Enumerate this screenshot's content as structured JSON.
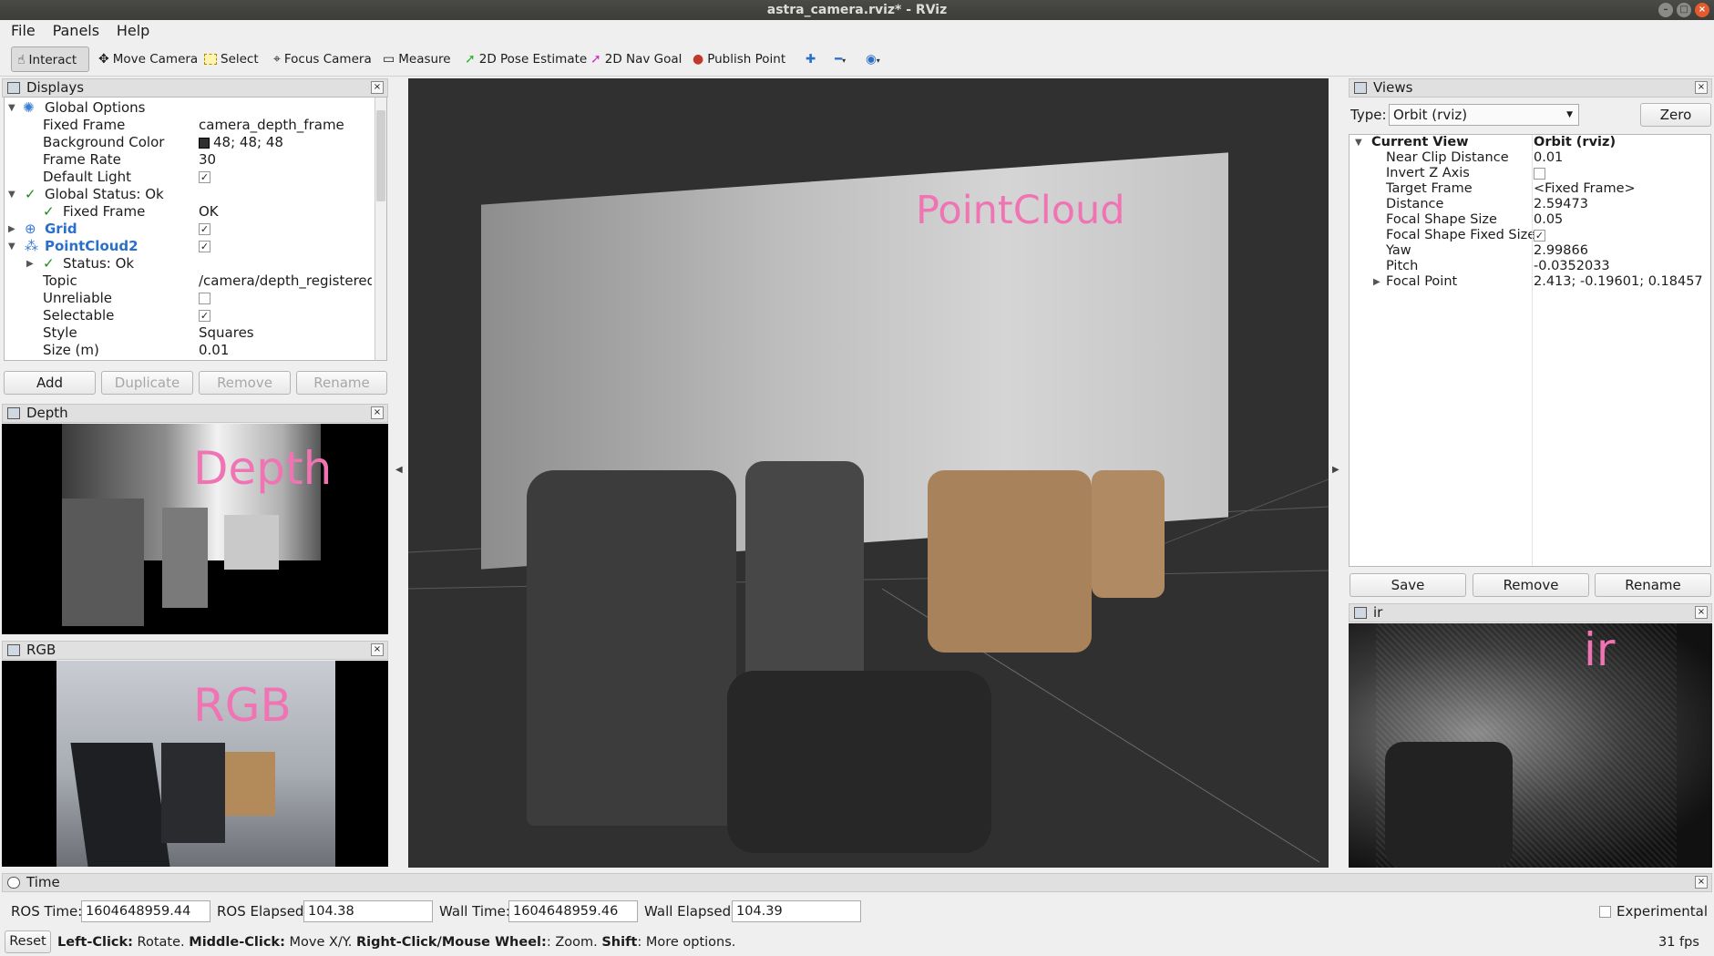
{
  "window": {
    "title": "astra_camera.rviz* - RViz"
  },
  "menu": {
    "items": [
      "File",
      "Panels",
      "Help"
    ]
  },
  "toolbar": {
    "tools": [
      "Interact",
      "Move Camera",
      "Select",
      "Focus Camera",
      "Measure",
      "2D Pose Estimate",
      "2D Nav Goal",
      "Publish Point"
    ],
    "active": "Interact"
  },
  "displays": {
    "title": "Displays",
    "rows": [
      {
        "key": "Global Options",
        "value": ""
      },
      {
        "key": "Fixed Frame",
        "value": "camera_depth_frame"
      },
      {
        "key": "Background Color",
        "value": "48; 48; 48"
      },
      {
        "key": "Frame Rate",
        "value": "30"
      },
      {
        "key": "Default Light",
        "value": "✓"
      },
      {
        "key": "Global Status: Ok",
        "value": ""
      },
      {
        "key": "Fixed Frame",
        "value": "OK"
      },
      {
        "key": "Grid",
        "value": "✓"
      },
      {
        "key": "PointCloud2",
        "value": "✓"
      },
      {
        "key": "Status: Ok",
        "value": ""
      },
      {
        "key": "Topic",
        "value": "/camera/depth_registered/..."
      },
      {
        "key": "Unreliable",
        "value": ""
      },
      {
        "key": "Selectable",
        "value": "✓"
      },
      {
        "key": "Style",
        "value": "Squares"
      },
      {
        "key": "Size (m)",
        "value": "0.01"
      }
    ],
    "buttons": {
      "add": "Add",
      "duplicate": "Duplicate",
      "remove": "Remove",
      "rename": "Rename"
    }
  },
  "depth": {
    "title": "Depth",
    "label": "Depth"
  },
  "rgb": {
    "title": "RGB",
    "label": "RGB"
  },
  "viewport": {
    "label": "PointCloud"
  },
  "views": {
    "title": "Views",
    "type_label": "Type:",
    "type_value": "Orbit (rviz)",
    "zero": "Zero",
    "header_key": "Current View",
    "header_value": "Orbit (rviz)",
    "rows": [
      {
        "key": "Near Clip Distance",
        "value": "0.01"
      },
      {
        "key": "Invert Z Axis",
        "value": ""
      },
      {
        "key": "Target Frame",
        "value": "<Fixed Frame>"
      },
      {
        "key": "Distance",
        "value": "2.59473"
      },
      {
        "key": "Focal Shape Size",
        "value": "0.05"
      },
      {
        "key": "Focal Shape Fixed Size",
        "value": "✓"
      },
      {
        "key": "Yaw",
        "value": "2.99866"
      },
      {
        "key": "Pitch",
        "value": "-0.0352033"
      },
      {
        "key": "Focal Point",
        "value": "2.413; -0.19601; 0.18457"
      }
    ],
    "buttons": {
      "save": "Save",
      "remove": "Remove",
      "rename": "Rename"
    }
  },
  "ir": {
    "title": "ir",
    "label": "ir"
  },
  "time": {
    "title": "Time",
    "ros_time_label": "ROS Time:",
    "ros_time": "1604648959.44",
    "ros_elapsed_label": "ROS Elapsed:",
    "ros_elapsed": "104.38",
    "wall_time_label": "Wall Time:",
    "wall_time": "1604648959.46",
    "wall_elapsed_label": "Wall Elapsed:",
    "wall_elapsed": "104.39",
    "experimental": "Experimental"
  },
  "status": {
    "reset": "Reset",
    "k1": "Left-Click:",
    "v1": " Rotate. ",
    "k2": "Middle-Click:",
    "v2": " Move X/Y. ",
    "k3": "Right-Click/Mouse Wheel:",
    "v3": ": Zoom. ",
    "k4": "Shift",
    "v4": ": More options.",
    "fps": "31 fps"
  },
  "colors": {
    "background": "#303030",
    "swatch": "#303030",
    "label": "#f074b4"
  }
}
